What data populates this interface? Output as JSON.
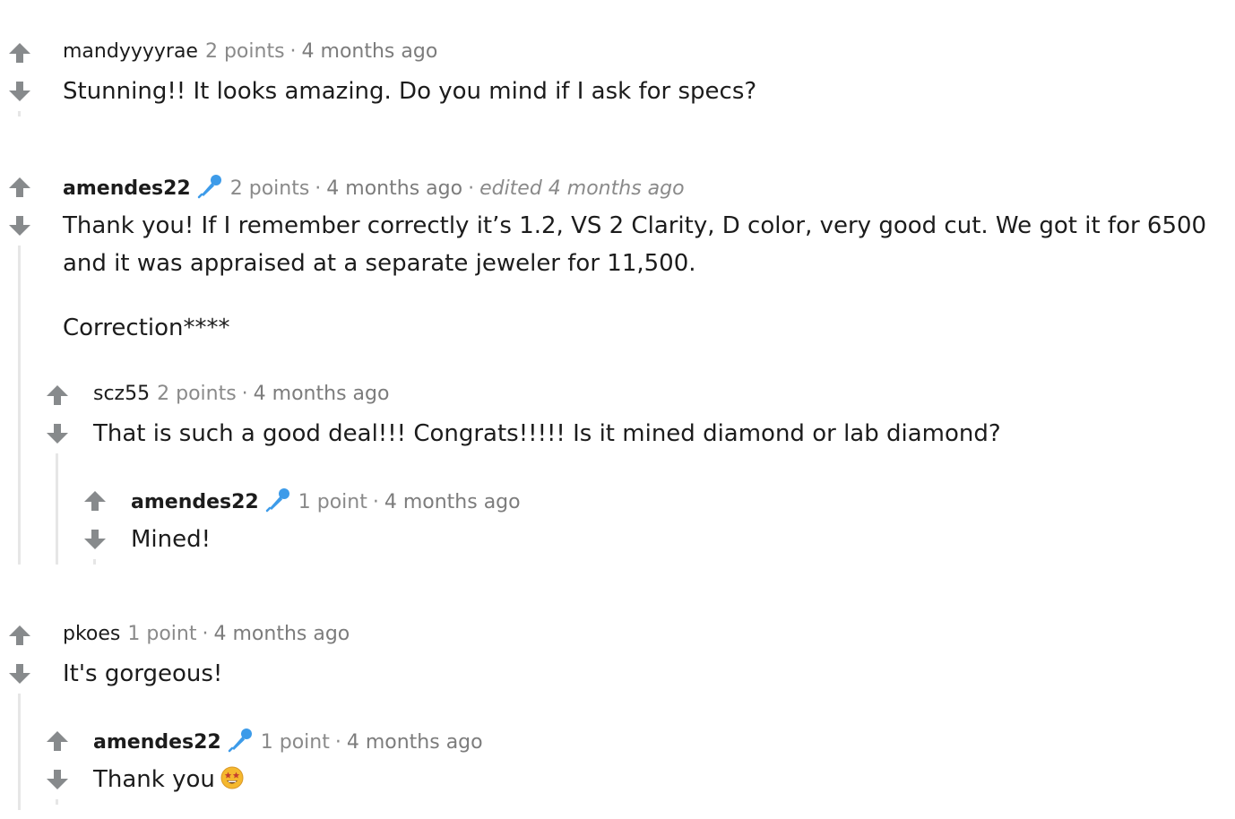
{
  "colors": {
    "vote_arrow": "#878a8c",
    "thread_line": "#e6e6e6",
    "mic_icon": "#3d9be9",
    "meta_text": "#7c7c7c",
    "body_text": "#1c1c1c"
  },
  "comments": [
    {
      "username": "mandyyyyrae",
      "score": "2 points",
      "separator": "·",
      "age": "4 months ago",
      "body": "Stunning!! It looks amazing. Do you mind if I ask for specs?"
    },
    {
      "username": "amendes22",
      "is_op": true,
      "flair_icon": "microphone-icon",
      "score": "2 points",
      "separator": "·",
      "age": "4 months ago",
      "separator2": "·",
      "edited": "edited 4 months ago",
      "body_line1": "Thank you! If I remember correctly it’s 1.2, VS 2 Clarity, D color, very good cut. We got it for 6500",
      "body_line2": "and it was appraised at a separate jeweler for 11,500.",
      "body_para2": "Correction****",
      "replies": [
        {
          "username": "scz55",
          "score": "2 points",
          "separator": "·",
          "age": "4 months ago",
          "body": "That is such a good deal!!! Congrats!!!!! Is it mined diamond or lab diamond?",
          "replies": [
            {
              "username": "amendes22",
              "is_op": true,
              "flair_icon": "microphone-icon",
              "score": "1 point",
              "separator": "·",
              "age": "4 months ago",
              "body": "Mined!"
            }
          ]
        }
      ]
    },
    {
      "username": "pkoes",
      "score": "1 point",
      "separator": "·",
      "age": "4 months ago",
      "body": "It's gorgeous!",
      "replies": [
        {
          "username": "amendes22",
          "is_op": true,
          "flair_icon": "microphone-icon",
          "score": "1 point",
          "separator": "·",
          "age": "4 months ago",
          "body": "Thank you",
          "emoji": "star-struck-emoji"
        }
      ]
    }
  ]
}
